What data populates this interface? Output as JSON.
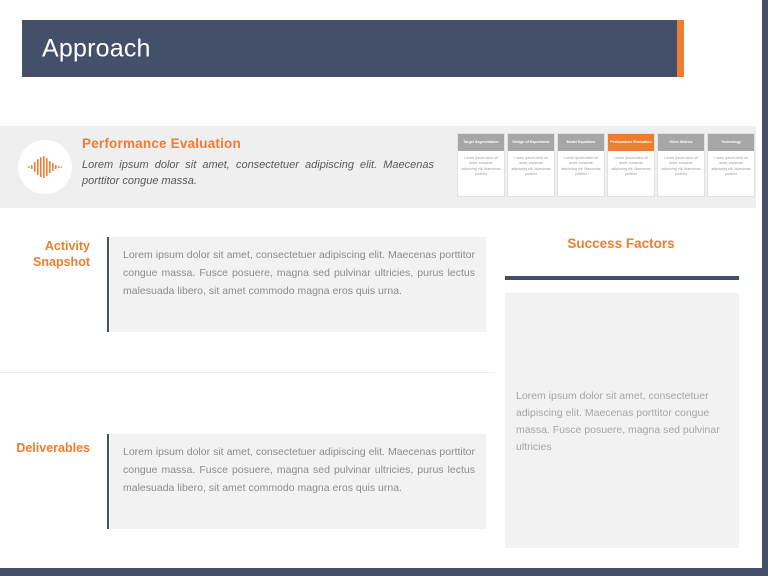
{
  "slide": {
    "title": "Approach"
  },
  "banner": {
    "icon": "audio-waveform-icon",
    "heading": "Performance Evaluation",
    "body": "Lorem ipsum dolor sit amet, consectetuer adipiscing elit. Maecenas porttitor congue massa."
  },
  "stage_cards": {
    "card_body": "Lorem ipsum dolor sit amet, consecte adipiscing elit. Maecenas porttitor",
    "items": [
      {
        "label": "Target Segmentation",
        "active": false
      },
      {
        "label": "Design of Experiment",
        "active": false
      },
      {
        "label": "Model Equations",
        "active": false
      },
      {
        "label": "Performance Evaluation",
        "active": true
      },
      {
        "label": "Other Metrics",
        "active": false
      },
      {
        "label": "Technology",
        "active": false
      }
    ]
  },
  "activity_snapshot": {
    "label": "Activity Snapshot",
    "body": "Lorem ipsum dolor sit amet, consectetuer adipiscing elit. Maecenas porttitor congue massa. Fusce posuere, magna sed pulvinar ultricies, purus lectus malesuada libero, sit amet commodo  magna eros quis urna."
  },
  "deliverables": {
    "label": "Deliverables",
    "body": "Lorem ipsum dolor sit amet, consectetuer adipiscing elit. Maecenas porttitor congue massa. Fusce posuere, magna sed pulvinar ultricies, purus lectus malesuada libero, sit amet commodo  magna eros quis urna."
  },
  "success_factors": {
    "title": "Success Factors",
    "body": "Lorem ipsum dolor sit amet, consectetuer adipiscing elit. Maecenas porttitor congue massa. Fusce posuere, magna sed pulvinar ultricies"
  },
  "colors": {
    "accent_orange": "#ed7d31",
    "dark_slate": "#44506a",
    "banner_grey": "#efefef",
    "panel_grey": "#f2f2f2",
    "card_head_grey": "#a6a6a6"
  }
}
